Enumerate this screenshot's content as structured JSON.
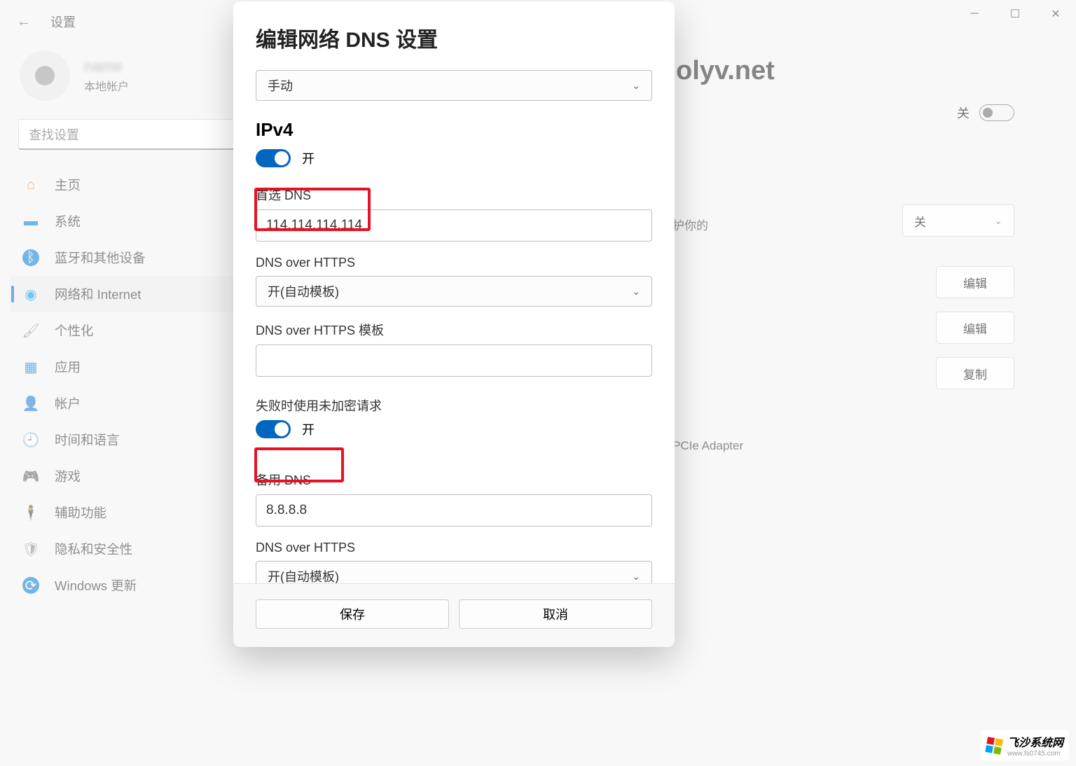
{
  "window": {
    "settings_title": "设置",
    "minimize": "─",
    "maximize": "☐",
    "close": "✕"
  },
  "user": {
    "name_blur": "name",
    "subtitle": "本地帐户"
  },
  "search": {
    "placeholder": "查找设置"
  },
  "nav": {
    "home": "主页",
    "system": "系统",
    "bluetooth": "蓝牙和其他设备",
    "network": "网络和 Internet",
    "personalization": "个性化",
    "apps": "应用",
    "accounts": "帐户",
    "time": "时间和语言",
    "gaming": "游戏",
    "accessibility": "辅助功能",
    "privacy": "隐私和安全性",
    "update": "Windows 更新"
  },
  "content": {
    "domain": "olyv.net",
    "toggle_off": "关",
    "protect_suffix": "护你的",
    "dropdown_off": "关",
    "edit": "编辑",
    "copy": "复制",
    "adapter_suffix": "PCIe Adapter"
  },
  "modal": {
    "title": "编辑网络 DNS 设置",
    "mode": "手动",
    "ipv4_heading": "IPv4",
    "on_label": "开",
    "preferred_dns_label": "首选 DNS",
    "preferred_dns_value": "114.114.114.114",
    "doh1_label": "DNS over HTTPS",
    "doh1_value": "开(自动模板)",
    "doh_template_label": "DNS over HTTPS 模板",
    "doh_template_value": "",
    "fallback_label": "失败时使用未加密请求",
    "alt_dns_label": "备用 DNS",
    "alt_dns_value": "8.8.8.8",
    "doh2_label": "DNS over HTTPS",
    "doh2_value": "开(自动模板)",
    "save": "保存",
    "cancel": "取消"
  },
  "watermark": {
    "main": "飞沙系统网",
    "sub": "www.fs0745.com"
  }
}
